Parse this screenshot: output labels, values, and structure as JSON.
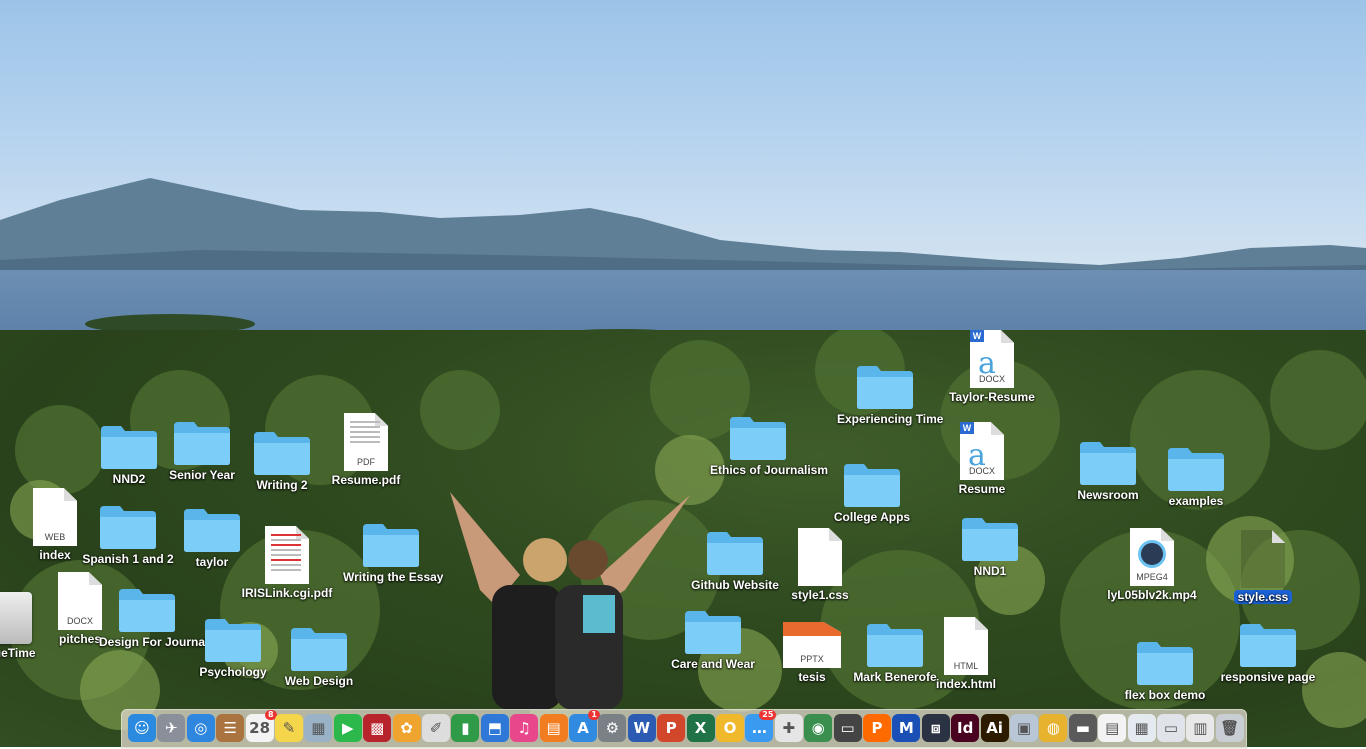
{
  "desktop": {
    "icons": [
      {
        "label": "NND2",
        "type": "folder"
      },
      {
        "label": "Senior Year",
        "type": "folder"
      },
      {
        "label": "Writing 2",
        "type": "folder"
      },
      {
        "label": "Resume.pdf",
        "type": "pdf",
        "ext": "PDF"
      },
      {
        "label": "index",
        "type": "file",
        "ext": "WEB"
      },
      {
        "label": "Spanish 1 and 2",
        "type": "folder"
      },
      {
        "label": "taylor",
        "type": "folder"
      },
      {
        "label": "IRISLink.cgi.pdf",
        "type": "pdf-preview"
      },
      {
        "label": "Writing the Essay",
        "type": "folder"
      },
      {
        "label": "pitches",
        "type": "file",
        "ext": "DOCX"
      },
      {
        "label": "Design For Journalists",
        "type": "folder"
      },
      {
        "label": "Psychology",
        "type": "folder"
      },
      {
        "label": "Web Design",
        "type": "folder"
      },
      {
        "label": "scueTime",
        "type": "drive"
      },
      {
        "label": "Ethics of Journalism",
        "type": "folder"
      },
      {
        "label": "Github Website",
        "type": "folder"
      },
      {
        "label": "style1.css",
        "type": "file",
        "ext": ""
      },
      {
        "label": "Care and Wear",
        "type": "folder"
      },
      {
        "label": "tesis",
        "type": "pptx",
        "ext": "PPTX"
      },
      {
        "label": "Experiencing Time",
        "type": "folder"
      },
      {
        "label": "College Apps",
        "type": "folder"
      },
      {
        "label": "Mark Benerofe",
        "type": "folder"
      },
      {
        "label": "Taylor-Resume",
        "type": "docx",
        "ext": "DOCX"
      },
      {
        "label": "Resume",
        "type": "docx",
        "ext": "DOCX"
      },
      {
        "label": "NND1",
        "type": "folder"
      },
      {
        "label": "index.html",
        "type": "file",
        "ext": "HTML"
      },
      {
        "label": "Newsroom",
        "type": "folder"
      },
      {
        "label": "examples",
        "type": "folder"
      },
      {
        "label": "lyL05blv2k.mp4",
        "type": "video",
        "ext": "MPEG4"
      },
      {
        "label": "style.css",
        "type": "file",
        "ext": ""
      },
      {
        "label": "flex box demo",
        "type": "folder"
      },
      {
        "label": "responsive page",
        "type": "folder"
      }
    ]
  },
  "dock": {
    "apps": [
      {
        "name": "finder-icon",
        "glyph": "☺",
        "color": "#2a8ae0"
      },
      {
        "name": "launchpad-icon",
        "glyph": "✈",
        "color": "#8a8f99"
      },
      {
        "name": "safari-icon",
        "glyph": "◎",
        "color": "#2f86de"
      },
      {
        "name": "contacts-icon",
        "glyph": "☰",
        "color": "#a9743f"
      },
      {
        "name": "calendar-icon",
        "glyph": "28",
        "color": "#f3f3f3",
        "badge": "8"
      },
      {
        "name": "notes-icon",
        "glyph": "✎",
        "color": "#f5d54a"
      },
      {
        "name": "preview-icon",
        "glyph": "▦",
        "color": "#9ab2c6"
      },
      {
        "name": "facetime-icon",
        "glyph": "▶",
        "color": "#2db84b"
      },
      {
        "name": "photo-booth-icon",
        "glyph": "▩",
        "color": "#b7242b"
      },
      {
        "name": "photos-icon",
        "glyph": "✿",
        "color": "#f0a430"
      },
      {
        "name": "textedit-icon",
        "glyph": "✐",
        "color": "#dddddd"
      },
      {
        "name": "numbers-icon",
        "glyph": "▮",
        "color": "#2f9a48"
      },
      {
        "name": "keynote-icon",
        "glyph": "⬒",
        "color": "#3078d8"
      },
      {
        "name": "itunes-icon",
        "glyph": "♫",
        "color": "#e8478b"
      },
      {
        "name": "ibooks-icon",
        "glyph": "▤",
        "color": "#f27d21"
      },
      {
        "name": "app-store-icon",
        "glyph": "A",
        "color": "#2f8ae0",
        "badge": "1"
      },
      {
        "name": "system-preferences-icon",
        "glyph": "⚙",
        "color": "#7b7f86"
      },
      {
        "name": "word-icon",
        "glyph": "W",
        "color": "#2b5bb2"
      },
      {
        "name": "powerpoint-icon",
        "glyph": "P",
        "color": "#d2462b"
      },
      {
        "name": "excel-icon",
        "glyph": "X",
        "color": "#207346"
      },
      {
        "name": "onenote-icon",
        "glyph": "O",
        "color": "#f0b92c"
      },
      {
        "name": "messages-icon",
        "glyph": "…",
        "color": "#3a9af0",
        "badge": "25"
      },
      {
        "name": "first-aid-icon",
        "glyph": "✚",
        "color": "#e5e5e5"
      },
      {
        "name": "globe-icon",
        "glyph": "◉",
        "color": "#3a8f4f"
      },
      {
        "name": "terminal-icon",
        "glyph": "▭",
        "color": "#444444"
      },
      {
        "name": "pages-icon",
        "glyph": "P",
        "color": "#ff6a00"
      },
      {
        "name": "malwarebytes-icon",
        "glyph": "M",
        "color": "#1a4fb5"
      },
      {
        "name": "brackets-icon",
        "glyph": "⧈",
        "color": "#2a3244"
      },
      {
        "name": "indesign-icon",
        "glyph": "Id",
        "color": "#49021f"
      },
      {
        "name": "illustrator-icon",
        "glyph": "Ai",
        "color": "#2d1b00"
      },
      {
        "name": "image-capture-icon",
        "glyph": "▣",
        "color": "#b8c6d6"
      },
      {
        "name": "chrome-icon",
        "glyph": "◍",
        "color": "#e7b22d"
      },
      {
        "name": "downloads-stack-icon",
        "glyph": "▬",
        "color": "#5a5a5a"
      },
      {
        "name": "documents-stack-icon",
        "glyph": "▤",
        "color": "#f3f3f3"
      },
      {
        "name": "screenshot-stack-icon",
        "glyph": "▦",
        "color": "#e5eaf0"
      },
      {
        "name": "window-stack-icon",
        "glyph": "▭",
        "color": "#e0e4ea"
      },
      {
        "name": "control-panel-stack-icon",
        "glyph": "▥",
        "color": "#e8e8e8"
      },
      {
        "name": "trash-icon",
        "glyph": "🗑",
        "color": "#c9ced4"
      }
    ]
  }
}
